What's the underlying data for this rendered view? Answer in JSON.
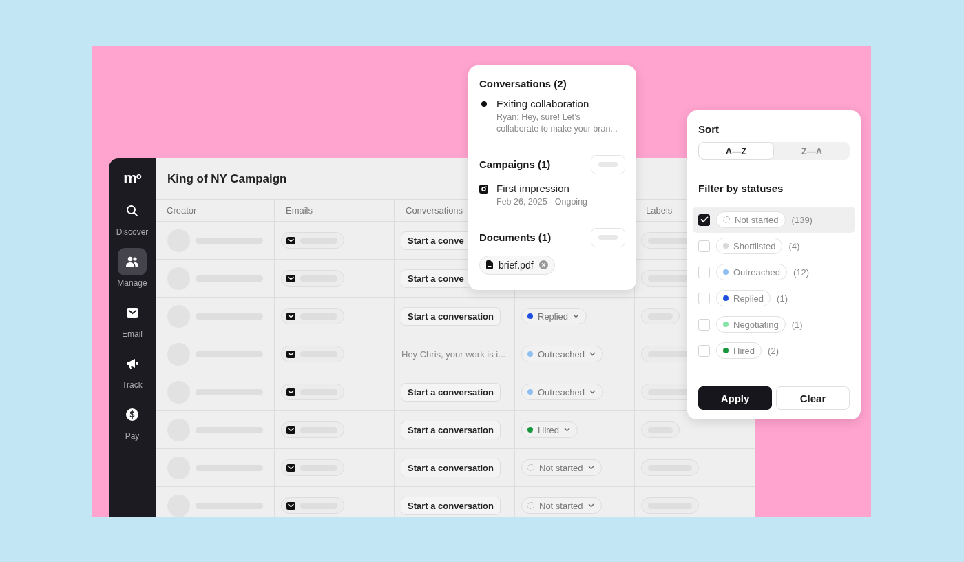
{
  "sidebar": {
    "logo": "m$^{o}$",
    "items": [
      {
        "label": "Discover",
        "selected": false
      },
      {
        "label": "Manage",
        "selected": true
      },
      {
        "label": "Email",
        "selected": false
      },
      {
        "label": "Track",
        "selected": false
      },
      {
        "label": "Pay",
        "selected": false
      }
    ]
  },
  "campaign": {
    "title": "King of NY Campaign"
  },
  "table": {
    "columns": [
      "Creator",
      "Emails",
      "Conversations",
      "",
      "Labels"
    ],
    "rows": [
      {
        "conversation": {
          "kind": "button",
          "text": "Start a conve"
        }
      },
      {
        "conversation": {
          "kind": "button",
          "text": "Start a conve"
        }
      },
      {
        "conversation": {
          "kind": "button",
          "text": "Start a conversation"
        },
        "status": {
          "label": "Replied",
          "kind": "dot",
          "color": "#1f4fe0"
        }
      },
      {
        "conversation": {
          "kind": "message",
          "text": "Hey Chris, your work is i..."
        },
        "status": {
          "label": "Outreached",
          "kind": "dot",
          "color": "#8dbff0"
        }
      },
      {
        "conversation": {
          "kind": "button",
          "text": "Start a conversation"
        },
        "status": {
          "label": "Outreached",
          "kind": "dot",
          "color": "#8dbff0"
        }
      },
      {
        "conversation": {
          "kind": "button",
          "text": "Start a conversation"
        },
        "status": {
          "label": "Hired",
          "kind": "dot",
          "color": "#17963b"
        }
      },
      {
        "conversation": {
          "kind": "button",
          "text": "Start a conversation"
        },
        "status": {
          "label": "Not started",
          "kind": "dashed"
        }
      },
      {
        "conversation": {
          "kind": "button",
          "text": "Start a conversation"
        },
        "status": {
          "label": "Not started",
          "kind": "dashed"
        }
      }
    ]
  },
  "details_popover": {
    "conversations": {
      "title": "Conversations (2)",
      "items": [
        {
          "title": "Exiting collaboration",
          "preview": "Ryan: Hey, sure! Let’s collaborate to make your bran..."
        }
      ]
    },
    "campaigns": {
      "title": "Campaigns (1)",
      "items": [
        {
          "title": "First impression",
          "subtitle": "Feb 26, 2025 - Ongoing"
        }
      ]
    },
    "documents": {
      "title": "Documents (1)",
      "files": [
        "brief.pdf"
      ]
    }
  },
  "filter_popover": {
    "sort_title": "Sort",
    "sort_options": [
      {
        "label": "A—Z",
        "selected": true
      },
      {
        "label": "Z—A",
        "selected": false
      }
    ],
    "filter_title": "Filter by statuses",
    "statuses": [
      {
        "label": "Not started",
        "count": "(139)",
        "checked": true,
        "kind": "dashed"
      },
      {
        "label": "Shortlisted",
        "count": "(4)",
        "checked": false,
        "kind": "dot",
        "color": "#d9d9d9"
      },
      {
        "label": "Outreached",
        "count": "(12)",
        "checked": false,
        "kind": "dot",
        "color": "#8dbff0"
      },
      {
        "label": "Replied",
        "count": "(1)",
        "checked": false,
        "kind": "dot",
        "color": "#1f4fe0"
      },
      {
        "label": "Negotiating",
        "count": "(1)",
        "checked": false,
        "kind": "dot",
        "color": "#86e3a8"
      },
      {
        "label": "Hired",
        "count": "(2)",
        "checked": false,
        "kind": "dot",
        "color": "#17963b"
      }
    ],
    "buttons": [
      {
        "label": "Apply",
        "kind": "primary"
      },
      {
        "label": "Clear",
        "kind": "secondary"
      }
    ]
  }
}
